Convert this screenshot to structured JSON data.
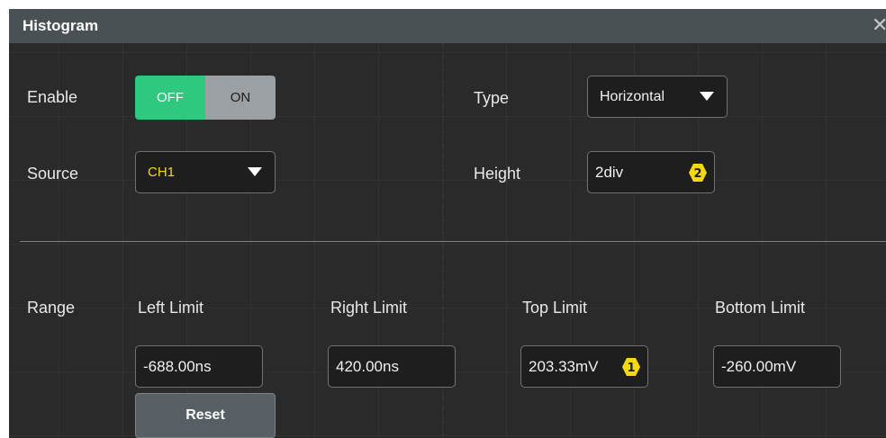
{
  "dialog": {
    "title": "Histogram",
    "close_glyph": "✕"
  },
  "enable": {
    "label": "Enable",
    "off_label": "OFF",
    "on_label": "ON",
    "selected": "OFF"
  },
  "type": {
    "label": "Type",
    "value": "Horizontal"
  },
  "source": {
    "label": "Source",
    "value": "CH1"
  },
  "height": {
    "label": "Height",
    "value": "2div",
    "badge": "2"
  },
  "range": {
    "label": "Range",
    "left_limit_label": "Left Limit",
    "left_limit_value": "-688.00ns",
    "right_limit_label": "Right Limit",
    "right_limit_value": "420.00ns",
    "top_limit_label": "Top Limit",
    "top_limit_value": "203.33mV",
    "top_limit_badge": "1",
    "bottom_limit_label": "Bottom Limit",
    "bottom_limit_value": "-260.00mV",
    "reset_label": "Reset"
  },
  "colors": {
    "toggle_active": "#2ec97e",
    "toggle_inactive": "#9aa0a4",
    "source_text": "#f5d90a",
    "badge": "#f5d90a"
  },
  "icons": {
    "close": "close-icon",
    "dropdown": "caret-down-icon",
    "knob_badge": "hexagon-badge-icon"
  }
}
